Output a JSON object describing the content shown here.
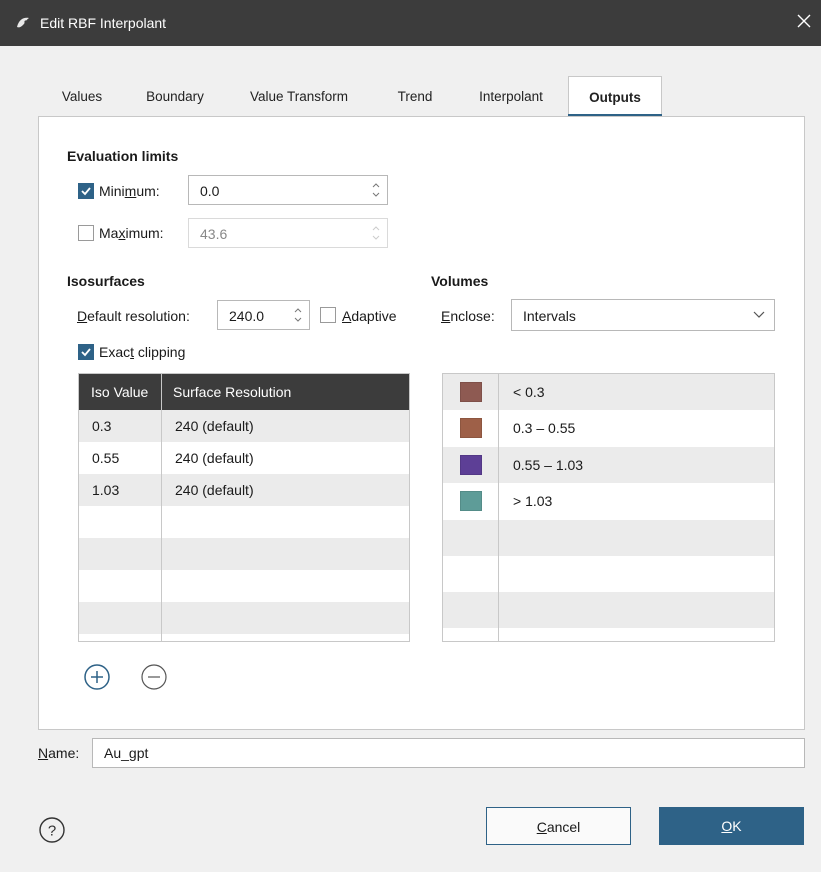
{
  "window": {
    "title": "Edit RBF Interpolant"
  },
  "tabs": [
    {
      "label": "Values",
      "active": false
    },
    {
      "label": "Boundary",
      "active": false
    },
    {
      "label": "Value Transform",
      "active": false
    },
    {
      "label": "Trend",
      "active": false
    },
    {
      "label": "Interpolant",
      "active": false
    },
    {
      "label": "Outputs",
      "active": true
    }
  ],
  "evaluation_limits": {
    "title": "Evaluation limits",
    "minimum": {
      "label_pre": "Mini",
      "label_underline": "m",
      "label_post": "um:",
      "checked": true,
      "value": "0.0"
    },
    "maximum": {
      "label_pre": "Ma",
      "label_underline": "x",
      "label_post": "imum:",
      "checked": false,
      "value": "43.6"
    }
  },
  "isosurfaces": {
    "title": "Isosurfaces",
    "default_resolution_pre": "",
    "default_resolution_underline": "D",
    "default_resolution_post": "efault resolution:",
    "default_resolution_value": "240.0",
    "adaptive_underline": "A",
    "adaptive_post": "daptive",
    "adaptive_checked": false,
    "exact_clipping_pre": "Exac",
    "exact_clipping_underline": "t",
    "exact_clipping_post": " clipping",
    "exact_clipping_checked": true,
    "columns": [
      "Iso Value",
      "Surface Resolution"
    ],
    "rows": [
      {
        "iso": "0.3",
        "res": "240 (default)"
      },
      {
        "iso": "0.55",
        "res": "240 (default)"
      },
      {
        "iso": "1.03",
        "res": "240 (default)"
      }
    ]
  },
  "volumes": {
    "title": "Volumes",
    "enclose_underline": "E",
    "enclose_post": "nclose:",
    "enclose_value": "Intervals",
    "rows": [
      {
        "label": "< 0.3",
        "color": "#8e5a52"
      },
      {
        "label": "0.3 – 0.55",
        "color": "#9e6048"
      },
      {
        "label": "0.55 – 1.03",
        "color": "#5d3f96"
      },
      {
        "label": "> 1.03",
        "color": "#5e9c98"
      }
    ]
  },
  "name": {
    "label_underline": "N",
    "label_post": "ame:",
    "value": "Au_gpt"
  },
  "buttons": {
    "cancel_underline": "C",
    "cancel_post": "ancel",
    "ok_underline": "O",
    "ok_post": "K"
  },
  "colors": {
    "accent": "#2e6287",
    "header_bg": "#3c3c3c"
  }
}
